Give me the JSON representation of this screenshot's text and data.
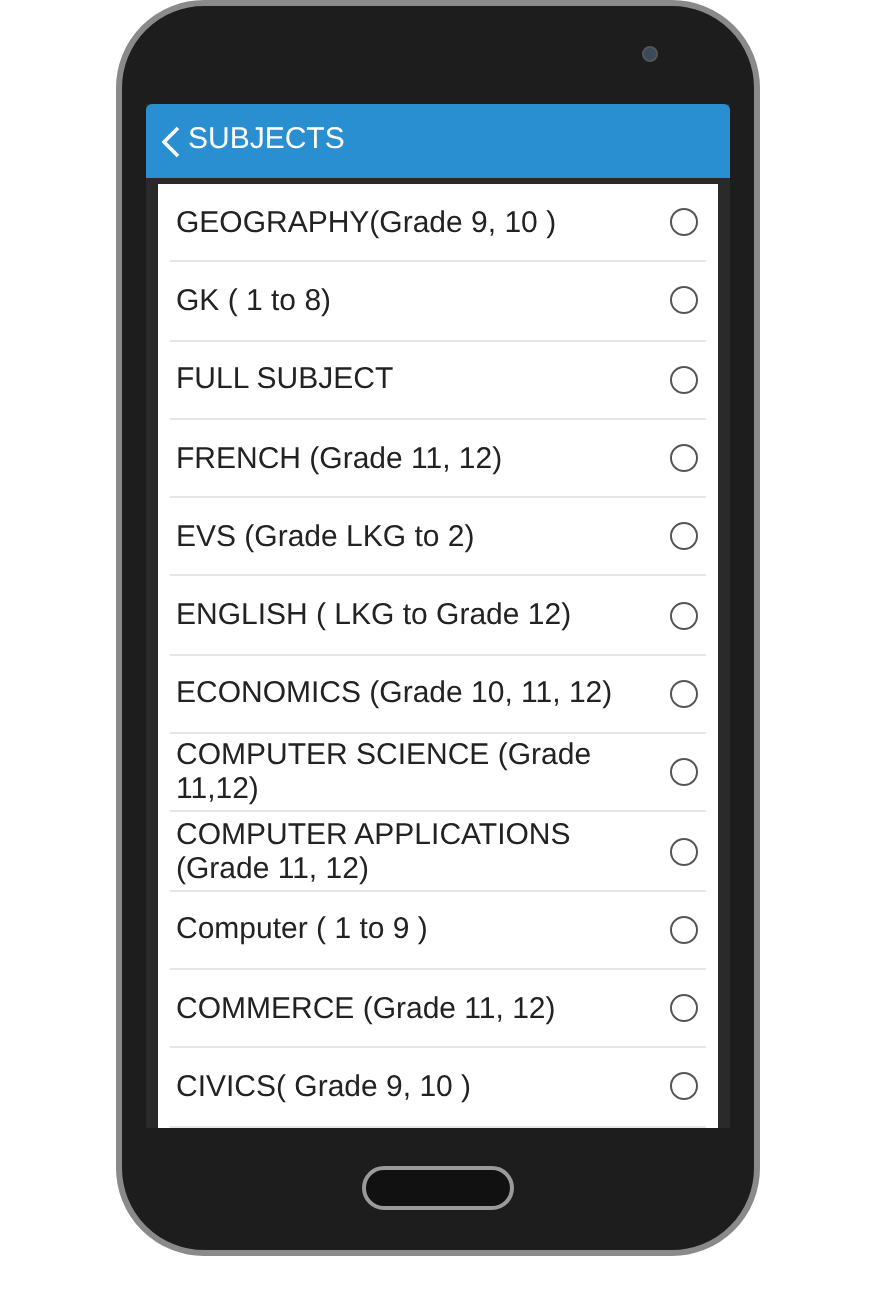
{
  "header": {
    "title": "SUBJECTS"
  },
  "subjects": [
    {
      "label": "GEOGRAPHY(Grade 9, 10 )",
      "selected": false
    },
    {
      "label": "GK ( 1 to 8)",
      "selected": false
    },
    {
      "label": "FULL SUBJECT",
      "selected": false
    },
    {
      "label": "FRENCH (Grade 11, 12)",
      "selected": false
    },
    {
      "label": "EVS (Grade LKG to 2)",
      "selected": false
    },
    {
      "label": "ENGLISH ( LKG to Grade 12)",
      "selected": false
    },
    {
      "label": "ECONOMICS (Grade 10, 11, 12)",
      "selected": false
    },
    {
      "label": "COMPUTER SCIENCE (Grade 11,12)",
      "selected": false
    },
    {
      "label": "COMPUTER APPLICATIONS (Grade 11, 12)",
      "selected": false
    },
    {
      "label": "Computer ( 1 to 9 )",
      "selected": false
    },
    {
      "label": "COMMERCE (Grade 11, 12)",
      "selected": false
    },
    {
      "label": "CIVICS( Grade 9, 10 )",
      "selected": false
    }
  ]
}
